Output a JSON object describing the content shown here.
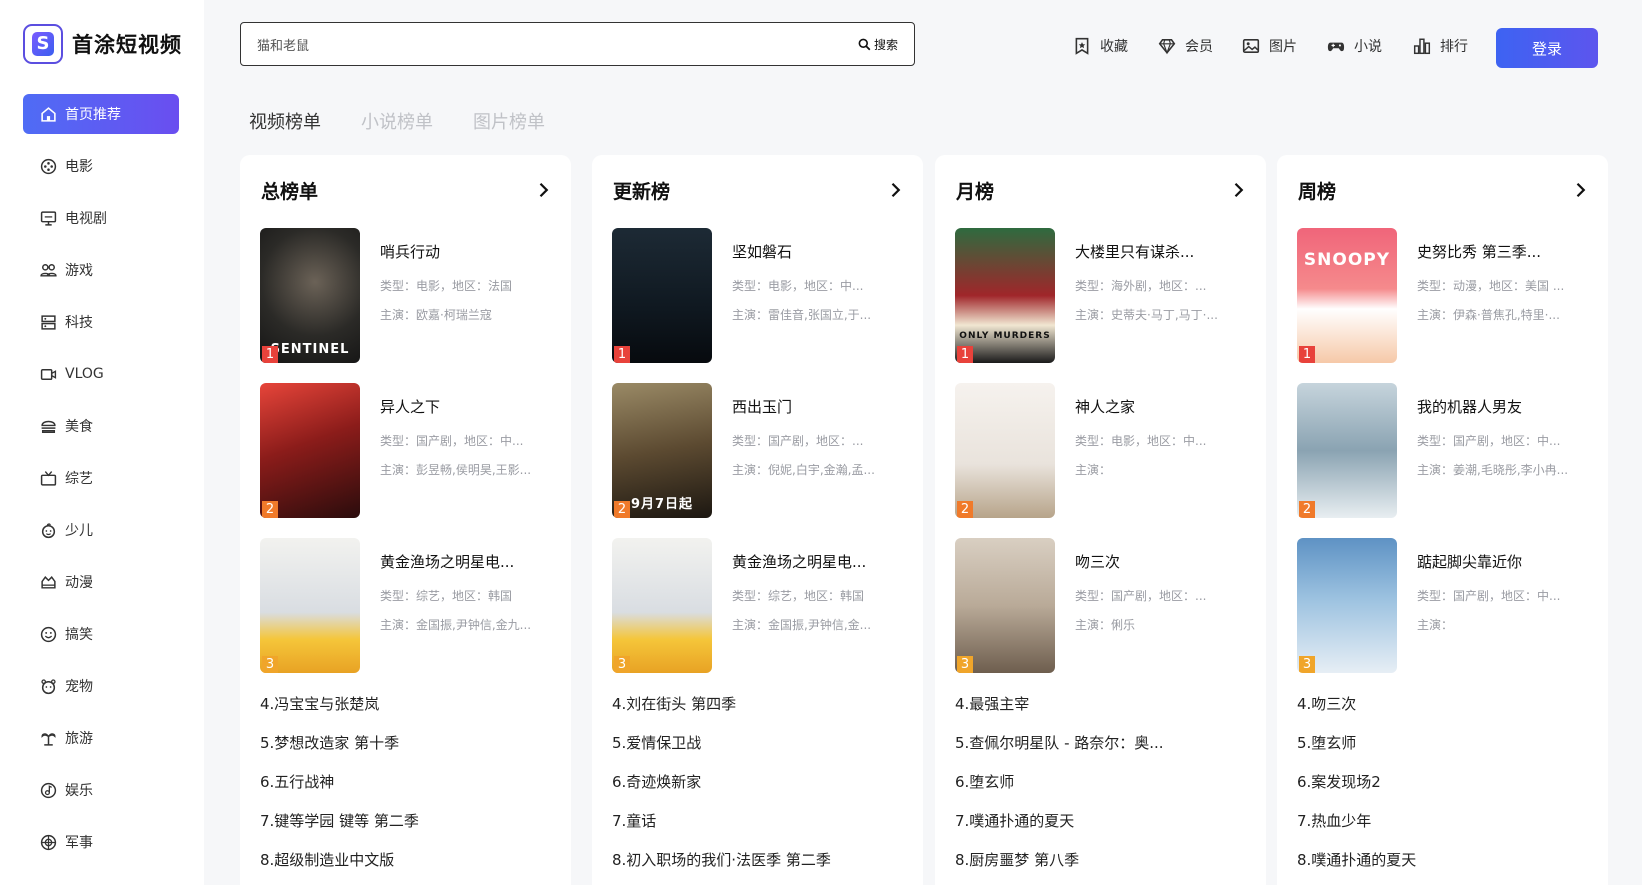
{
  "app": {
    "name": "首涂短视频",
    "logo_letter": "S"
  },
  "sidebar": {
    "items": [
      {
        "label": "首页推荐",
        "icon": "home-icon"
      },
      {
        "label": "电影",
        "icon": "film-reel-icon"
      },
      {
        "label": "电视剧",
        "icon": "tv-icon"
      },
      {
        "label": "游戏",
        "icon": "users-icon"
      },
      {
        "label": "科技",
        "icon": "server-icon"
      },
      {
        "label": "VLOG",
        "icon": "video-camera-icon"
      },
      {
        "label": "美食",
        "icon": "burger-icon"
      },
      {
        "label": "综艺",
        "icon": "tv-antenna-icon"
      },
      {
        "label": "少儿",
        "icon": "child-face-icon"
      },
      {
        "label": "动漫",
        "icon": "anime-icon"
      },
      {
        "label": "搞笑",
        "icon": "smile-icon"
      },
      {
        "label": "宠物",
        "icon": "pet-icon"
      },
      {
        "label": "旅游",
        "icon": "palm-tree-icon"
      },
      {
        "label": "娱乐",
        "icon": "music-disc-icon"
      },
      {
        "label": "军事",
        "icon": "target-icon"
      }
    ]
  },
  "search": {
    "value": "猫和老鼠",
    "button_label": "搜索"
  },
  "topnav": {
    "favorites": "收藏",
    "vip": "会员",
    "images": "图片",
    "novels": "小说",
    "ranking": "排行",
    "login": "登录"
  },
  "tabs": [
    "视频榜单",
    "小说榜单",
    "图片榜单"
  ],
  "boards": [
    {
      "title": "总榜单",
      "top": [
        {
          "rank": "1",
          "title": "哨兵行动",
          "type": "类型：电影，地区：法国",
          "cast": "主演：欧嘉·柯瑞兰寇",
          "poster_text": "SENTINEL"
        },
        {
          "rank": "2",
          "title": "异人之下",
          "type": "类型：国产剧，地区：中...",
          "cast": "主演：彭昱畅,侯明昊,王影...",
          "poster_text": ""
        },
        {
          "rank": "3",
          "title": "黄金渔场之明星电...",
          "type": "类型：综艺，地区：韩国",
          "cast": "主演：金国振,尹钟信,金九...",
          "poster_text": ""
        }
      ],
      "list": [
        "4.冯宝宝与张楚岚",
        "5.梦想改造家 第十季",
        "6.五行战神",
        "7.键等学园 键等 第二季",
        "8.超级制造业中文版"
      ]
    },
    {
      "title": "更新榜",
      "top": [
        {
          "rank": "1",
          "title": "坚如磐石",
          "type": "类型：电影，地区：中...",
          "cast": "主演：雷佳音,张国立,于...",
          "poster_text": ""
        },
        {
          "rank": "2",
          "title": "西出玉门",
          "type": "类型：国产剧，地区：...",
          "cast": "主演：倪妮,白宇,金瀚,孟...",
          "poster_text": "9月7日起"
        },
        {
          "rank": "3",
          "title": "黄金渔场之明星电...",
          "type": "类型：综艺，地区：韩国",
          "cast": "主演：金国振,尹钟信,金...",
          "poster_text": ""
        }
      ],
      "list": [
        "4.刘在街头 第四季",
        "5.爱情保卫战",
        "6.奇迹焕新家",
        "7.童话",
        "8.初入职场的我们·法医季 第二季"
      ]
    },
    {
      "title": "月榜",
      "top": [
        {
          "rank": "1",
          "title": "大楼里只有谋杀...",
          "type": "类型：海外剧，地区：...",
          "cast": "主演：史蒂夫·马丁,马丁·...",
          "poster_text": "ONLY MURDERS"
        },
        {
          "rank": "2",
          "title": "神人之家",
          "type": "类型：电影，地区：中...",
          "cast": "主演：",
          "poster_text": ""
        },
        {
          "rank": "3",
          "title": "吻三次",
          "type": "类型：国产剧，地区：...",
          "cast": "主演：俐乐",
          "poster_text": ""
        }
      ],
      "list": [
        "4.最强主宰",
        "5.查佩尔明星队 - 路奈尔：奥...",
        "6.堕玄师",
        "7.噗通扑通的夏天",
        "8.厨房噩梦 第八季"
      ]
    },
    {
      "title": "周榜",
      "top": [
        {
          "rank": "1",
          "title": "史努比秀 第三季...",
          "type": "类型：动漫，地区：美国 ...",
          "cast": "主演：伊森·普焦孔,特里·...",
          "poster_text": "SNOOPY"
        },
        {
          "rank": "2",
          "title": "我的机器人男友",
          "type": "类型：国产剧，地区：中...",
          "cast": "主演：姜潮,毛晓彤,李小冉...",
          "poster_text": ""
        },
        {
          "rank": "3",
          "title": "踮起脚尖靠近你",
          "type": "类型：国产剧，地区：中...",
          "cast": "主演：",
          "poster_text": ""
        }
      ],
      "list": [
        "4.吻三次",
        "5.堕玄师",
        "6.案发现场2",
        "7.热血少年",
        "8.噗通扑通的夏天"
      ]
    }
  ],
  "colors": {
    "accent": "#4f63f2",
    "rank1": "#e8423b",
    "rank2": "#f07a2a",
    "rank3": "#f0a52a"
  }
}
